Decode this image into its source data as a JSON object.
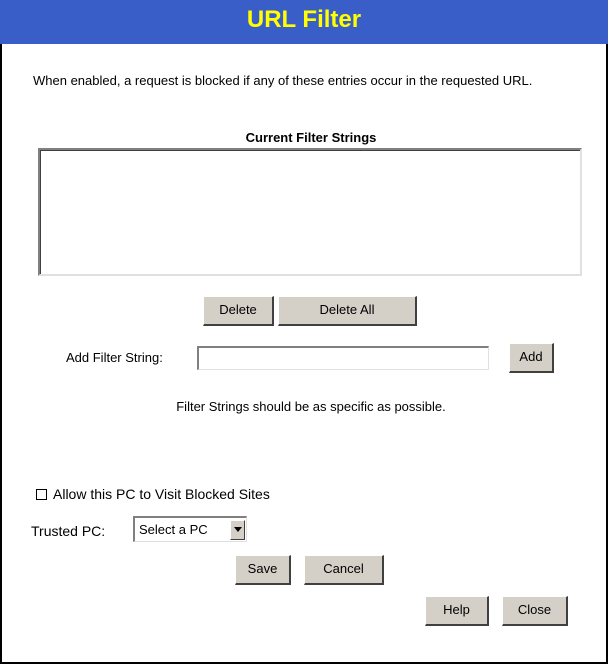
{
  "header": {
    "title": "URL Filter"
  },
  "description": "When enabled, a request is blocked if any of these entries occur in the requested URL.",
  "filter_list": {
    "label": "Current Filter Strings",
    "items": []
  },
  "buttons": {
    "delete": "Delete",
    "delete_all": "Delete All",
    "add": "Add",
    "save": "Save",
    "cancel": "Cancel",
    "help": "Help",
    "close": "Close"
  },
  "add_filter": {
    "label": "Add Filter String:",
    "value": ""
  },
  "hint": "Filter Strings should be as specific as possible.",
  "allow_checkbox": {
    "label": "Allow this PC to Visit Blocked Sites",
    "checked": false
  },
  "trusted_pc": {
    "label": "Trusted PC:",
    "selected": "Select a PC"
  },
  "colors": {
    "header_bg": "#3a5ec7",
    "header_text": "#ffff00",
    "button_face": "#d4d0c8"
  }
}
